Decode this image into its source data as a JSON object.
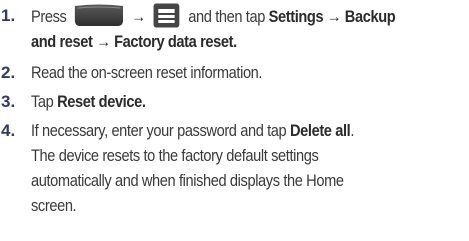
{
  "steps": [
    {
      "number": "1.",
      "line1_pre": "Press",
      "line1_arrow": "→",
      "line1_mid": "and then tap",
      "line1_bold": "Settings → Backup",
      "line2_bold": "and reset → Factory data reset."
    },
    {
      "number": "2.",
      "text": "Read the on-screen reset information."
    },
    {
      "number": "3.",
      "pre": "Tap",
      "bold": "Reset device."
    },
    {
      "number": "4.",
      "line1_pre": "If necessary, enter your password and tap",
      "line1_bold": "Delete all",
      "line1_post": ".",
      "line2": "The device resets to the factory default settings",
      "line3": "automatically and when finished displays the Home",
      "line4": "screen."
    }
  ],
  "icons": {
    "home_key": "home-key-icon",
    "menu_key": "menu-key-icon"
  },
  "colors": {
    "step_number": "#2f3a6e",
    "body_text": "#3a3a3a",
    "key_fill": "#4a4a4a"
  }
}
